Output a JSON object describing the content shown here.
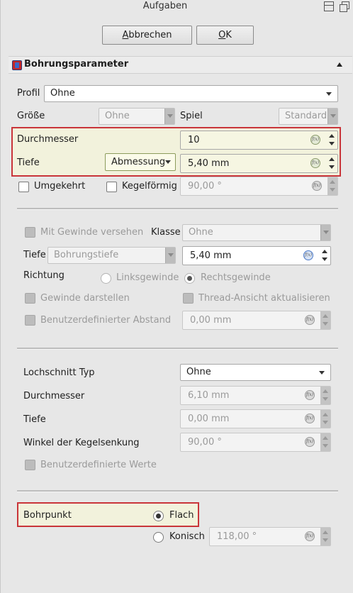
{
  "window": {
    "title": "Aufgaben"
  },
  "dialog": {
    "cancel_label": "Abbrechen",
    "ok_label": "OK"
  },
  "section": {
    "title": "Bohrungsparameter"
  },
  "profil": {
    "label": "Profil",
    "value": "Ohne"
  },
  "groesse": {
    "label": "Größe",
    "value": "Ohne"
  },
  "spiel": {
    "label": "Spiel",
    "value": "Standard"
  },
  "durchmesser": {
    "label": "Durchmesser",
    "value": "10"
  },
  "tiefe": {
    "label": "Tiefe",
    "mode": "Abmessung",
    "value": "5,40 mm"
  },
  "umgekehrt": {
    "label": "Umgekehrt",
    "checked": false
  },
  "kegel": {
    "label": "Kegelförmig",
    "checked": false,
    "value": "90,00 °"
  },
  "gewinde": {
    "mit_gewinde_label": "Mit Gewinde versehen",
    "klasse_label": "Klasse",
    "klasse_value": "Ohne",
    "tiefe_label": "Tiefe",
    "tiefe_mode": "Bohrungstiefe",
    "tiefe_value": "5,40 mm",
    "richtung_label": "Richtung",
    "links_label": "Linksgewinde",
    "rechts_label": "Rechtsgewinde",
    "darstellen_label": "Gewinde darstellen",
    "ansicht_label": "Thread-Ansicht aktualisieren",
    "abstand_label": "Benutzerdefinierter Abstand",
    "abstand_value": "0,00 mm"
  },
  "lochschnitt": {
    "typ_label": "Lochschnitt Typ",
    "typ_value": "Ohne",
    "durchmesser_label": "Durchmesser",
    "durchmesser_value": "6,10 mm",
    "tiefe_label": "Tiefe",
    "tiefe_value": "0,00 mm",
    "winkel_label": "Winkel der Kegelsenkung",
    "winkel_value": "90,00 °",
    "benutzer_label": "Benutzerdefinierte Werte"
  },
  "bohrpunkt": {
    "label": "Bohrpunkt",
    "flach_label": "Flach",
    "konisch_label": "Konisch",
    "konisch_value": "118,00 °",
    "selected": "Flach"
  }
}
